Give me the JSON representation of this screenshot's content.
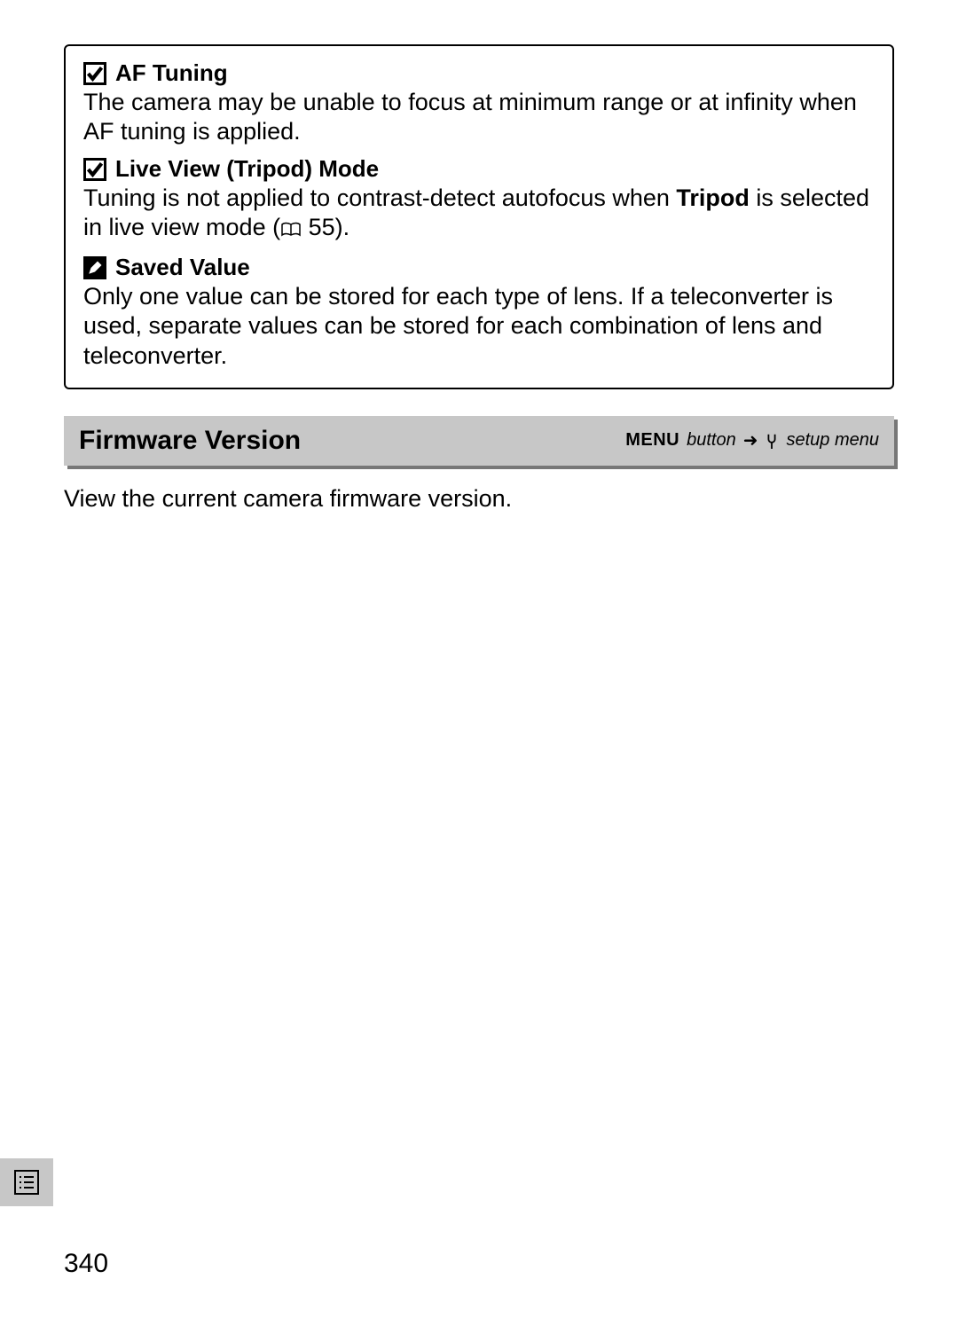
{
  "notes": [
    {
      "title": "AF Tuning",
      "icon_type": "caution",
      "body_pre": "The camera may be unable to focus at minimum range or at infinity when AF tuning is applied.",
      "body_bold": "",
      "body_post": ""
    },
    {
      "title": "Live View (Tripod) Mode",
      "icon_type": "caution",
      "body_pre": "Tuning is not applied to contrast-detect autofocus when ",
      "body_bold": "Tripod",
      "body_post": " is selected in live view mode (",
      "page_ref": "55",
      "body_tail": ")."
    },
    {
      "title": "Saved Value",
      "icon_type": "note",
      "body_pre": "Only one value can be stored for each type of lens.  If a teleconverter is used, separate values can be stored for each combination of lens and teleconverter.",
      "body_bold": "",
      "body_post": ""
    }
  ],
  "section": {
    "title": "Firmware Version",
    "path_menu": "MENU",
    "path_button": "button",
    "path_dest": "setup menu",
    "body": "View the current camera firmware version."
  },
  "page_number": "340"
}
